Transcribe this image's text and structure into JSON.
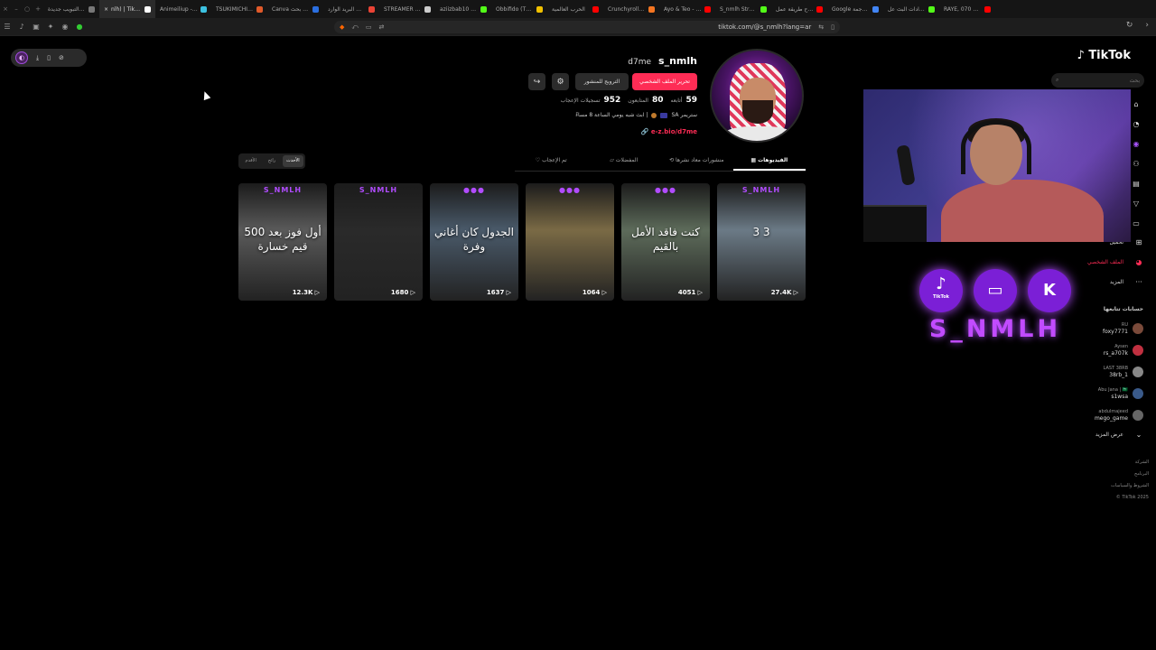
{
  "browser": {
    "tabs": [
      {
        "title": "علامة التبويب جديدة",
        "color": "#777777"
      },
      {
        "title": "nlh) | TikTok",
        "color": "#ffffff",
        "active": true
      },
      {
        "title": "Animeiliup - ار",
        "color": "#3cc1e0"
      },
      {
        "title": "TSUKIMICHI -M",
        "color": "#e05a2a"
      },
      {
        "title": "Canva عي بحث",
        "color": "#2b6fe0"
      },
      {
        "title": "البريد الوارد mail",
        "color": "#ea4335"
      },
      {
        "title": "STREAMER SLE",
        "color": "#cccccc"
      },
      {
        "title": "aziizbab10 Strea",
        "color": "#53fc18"
      },
      {
        "title": "Öbbifido (TV Str",
        "color": "#f0c000"
      },
      {
        "title": "الحرب العالمية",
        "color": "#ff0000"
      },
      {
        "title": "Crunchyroll: Wa",
        "color": "#f47521"
      },
      {
        "title": "Ayo & Teo - Rol",
        "color": "#ff0000"
      },
      {
        "title": "S_nmlh Stream",
        "color": "#53fc18"
      },
      {
        "title": "شرح طريقة عمل",
        "color": "#ff0000"
      },
      {
        "title": "Google الترجمة",
        "color": "#4285f4"
      },
      {
        "title": "إعدادات البث عل",
        "color": "#53fc18"
      },
      {
        "title": "RAYE, 070 Shaki",
        "color": "#ff0000"
      }
    ],
    "url": "tiktok.com/@s_nmlh?lang=ar"
  },
  "profile": {
    "username": "s_nmlh",
    "nickname": "d7me",
    "edit_label": "تحرير الملف الشخصي",
    "promote_label": "الترويج للمنشور",
    "stats": {
      "following": "59",
      "following_label": "أتابعه",
      "followers": "80",
      "followers_label": "المتابعون",
      "likes": "952",
      "likes_label": "تسجيلات الإعجاب"
    },
    "bio_line1": "ستريمر SA",
    "bio_line2": "| ابث شبه يومي الساعة 8 مساءً",
    "link": "e-z.bio/d7me"
  },
  "tabs": [
    {
      "label": "الفيديوهات",
      "icon": "grid-icon",
      "active": true
    },
    {
      "label": "منشورات معاد نشرها",
      "icon": "repost-icon"
    },
    {
      "label": "المفضلات",
      "icon": "bookmark-icon"
    },
    {
      "label": "تم الإعجاب",
      "icon": "heart-icon"
    }
  ],
  "sort": {
    "options": [
      {
        "label": "الأحدث",
        "active": true
      },
      {
        "label": "رائج"
      },
      {
        "label": "الأقدم"
      }
    ]
  },
  "videos": [
    {
      "views": "27.4K",
      "overlay": "3 3",
      "brand": "S_NMLH",
      "bg": "#6b7a86"
    },
    {
      "views": "4051",
      "overlay": "كنت فاقد الأمل بالقيم",
      "brand": "●●●",
      "bg": "#5d6b5a"
    },
    {
      "views": "1064",
      "overlay": "",
      "brand": "●●●",
      "bg": "#7a6a45"
    },
    {
      "views": "1637",
      "overlay": "الجدول كان أغاني وفرة",
      "brand": "●●●",
      "bg": "#4a5a6a"
    },
    {
      "views": "1680",
      "overlay": "",
      "brand": "S_NMLH",
      "bg": "#2a2a2a"
    },
    {
      "views": "12.3K",
      "overlay": "أول فوز بعد 500 قيم خسارة",
      "brand": "S_NMLH",
      "bg": "#5a5a5a"
    }
  ],
  "sidebar": {
    "logo": "TikTok",
    "search_placeholder": "بحث",
    "nav_icons": [
      "home-icon",
      "explore-icon",
      "following-icon",
      "friends-icon",
      "upload-icon",
      "live-icon",
      "messages-icon"
    ],
    "upload": "تحميل",
    "profile": "الملف الشخصي",
    "more": "المزيد",
    "following_title": "حسابات تتابعها",
    "accounts": [
      {
        "name": "RU",
        "handle": "foxy7771"
      },
      {
        "name": "Aysen",
        "handle": "rs_a707k"
      },
      {
        "name": "LAST 38RB",
        "handle": "38rb_1"
      },
      {
        "name": "Abu Jana | 🇸🇦",
        "handle": "s1wsa"
      },
      {
        "name": "abdulmajeed",
        "handle": "mego_game"
      }
    ],
    "see_more": "عرض المزيد",
    "footer": [
      "الشركة",
      "البرنامج",
      "الشروط والسياسات",
      "TikTok 2025 ©"
    ]
  },
  "stream": {
    "social_names": [
      "TikTok",
      "Twitch",
      "Kick"
    ],
    "channel": "S_NMLH"
  },
  "colors": {
    "accent": "#fe2c55",
    "purple": "#b14cff"
  }
}
